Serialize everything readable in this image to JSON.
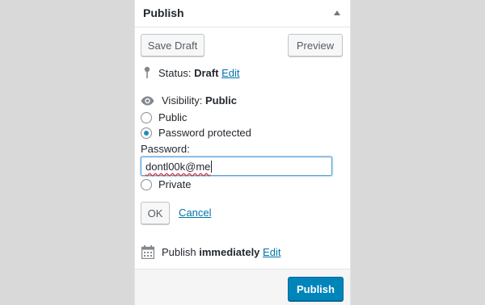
{
  "panel": {
    "title": "Publish"
  },
  "actions": {
    "save_draft_label": "Save Draft",
    "preview_label": "Preview"
  },
  "status": {
    "label": "Status:",
    "value": "Draft",
    "edit_label": "Edit"
  },
  "visibility": {
    "label": "Visibility:",
    "value": "Public",
    "options": [
      {
        "label": "Public",
        "checked": false
      },
      {
        "label": "Password protected",
        "checked": true
      },
      {
        "label": "Private",
        "checked": false
      }
    ],
    "password_label": "Password:",
    "password_value": "dontl00k@me",
    "ok_label": "OK",
    "cancel_label": "Cancel"
  },
  "schedule": {
    "label": "Publish",
    "value": "immediately",
    "edit_label": "Edit"
  },
  "footer": {
    "publish_label": "Publish"
  },
  "colors": {
    "accent": "#0085ba",
    "link": "#0073aa"
  },
  "icons": {
    "status": "pin-icon",
    "visibility": "eye-icon",
    "schedule": "calendar-icon",
    "toggle": "collapse-arrow-icon"
  }
}
